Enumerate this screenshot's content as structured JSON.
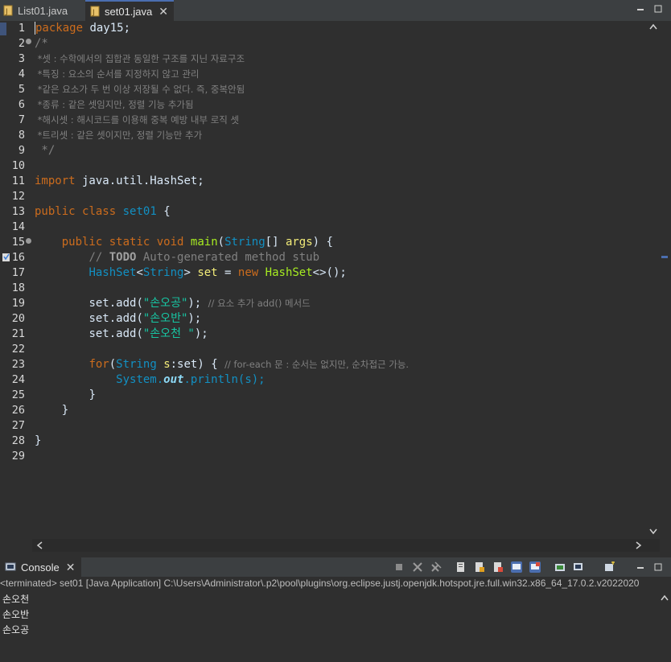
{
  "tabs": [
    {
      "label": "List01.java",
      "active": false
    },
    {
      "label": "set01.java",
      "active": true
    }
  ],
  "editor": {
    "line_numbers": [
      "1",
      "2",
      "3",
      "4",
      "5",
      "6",
      "7",
      "8",
      "9",
      "10",
      "11",
      "12",
      "13",
      "14",
      "15",
      "16",
      "17",
      "18",
      "19",
      "20",
      "21",
      "22",
      "23",
      "24",
      "25",
      "26",
      "27",
      "28",
      "29"
    ]
  },
  "code": {
    "l1_kw": "package",
    "l1_rest": " day15;",
    "l2": "/*",
    "l3": " *셋 : 수학에서의 집합관 동일한 구조를 지닌 자료구조",
    "l4": " *특징 : 요소의 순서를 지정하지 않고 관리",
    "l5": " *같은 요소가 두 번 이상 저장될 수 없다. 즉, 중복안됨",
    "l6": " *종류 : 같은 셋임지만, 정렬 기능 추가됨",
    "l7": " *해시셋 : 해시코드를 이용해 중복 예방 내부 로직 셋",
    "l8": " *트리셋 : 같은 셋이지만, 정렬 기능만 추가",
    "l9": " */",
    "l11_kw": "import",
    "l11_rest": " java.util.HashSet;",
    "l13_kw1": "public",
    "l13_kw2": "class",
    "l13_name": "set01",
    "l13_brace": " {",
    "l15_kw1": "public",
    "l15_kw2": "static",
    "l15_kw3": "void",
    "l15_fn": "main",
    "l15_type": "String",
    "l15_arr": "[] ",
    "l15_var": "args",
    "l15_end": ") {",
    "l16_slashes": "// ",
    "l16_todo": "TODO",
    "l16_rest": " Auto-generated method stub",
    "l17_type1": "HashSet",
    "l17_type2": "String",
    "l17_var": "set",
    "l17_kw": "new",
    "l17_type3": "HashSet",
    "l17_end": "<>();",
    "l19_pre": "set.add(",
    "l19_str": "\"손오공\"",
    "l19_post": "); ",
    "l19_cm": "// 요소 추가 add() 메서드",
    "l20_pre": "set.add(",
    "l20_str": "\"손오반\"",
    "l20_post": ");",
    "l21_pre": "set.add(",
    "l21_str": "\"손오천 \"",
    "l21_post": ");",
    "l23_kw": "for",
    "l23_type": "String",
    "l23_var": "s",
    "l23_mid": ":set) { ",
    "l23_cm": "// for-each 문 : 순서는 없지만, 순차접근 가능.",
    "l24_pre": "System.",
    "l24_field": "out",
    "l24_post": ".println(s);",
    "l25": "}",
    "l26": "}",
    "l28": "}"
  },
  "console": {
    "tab_label": "Console",
    "status": "<terminated> set01 [Java Application] C:\\Users\\Administrator\\.p2\\pool\\plugins\\org.eclipse.justj.openjdk.hotspot.jre.full.win32.x86_64_17.0.2.v2022020",
    "output": [
      "손오천",
      "손오반",
      "손오공"
    ]
  },
  "icons": [
    "java-file-icon",
    "close-icon",
    "minimize-icon",
    "maximize-icon",
    "console-icon",
    "terminate-icon",
    "remove-launch-icon",
    "remove-all-icon",
    "scroll-lock-icon",
    "word-wrap-icon",
    "pin-console-icon",
    "open-console-icon"
  ],
  "colors": {
    "editor_bg": "#2f2f2f",
    "keyword": "#cc6c1d",
    "string": "#17c6a3",
    "type": "#1290c3",
    "comment": "#808080",
    "method": "#a7ec21",
    "variable": "#f3ec79",
    "accent": "#4b6eaf"
  }
}
